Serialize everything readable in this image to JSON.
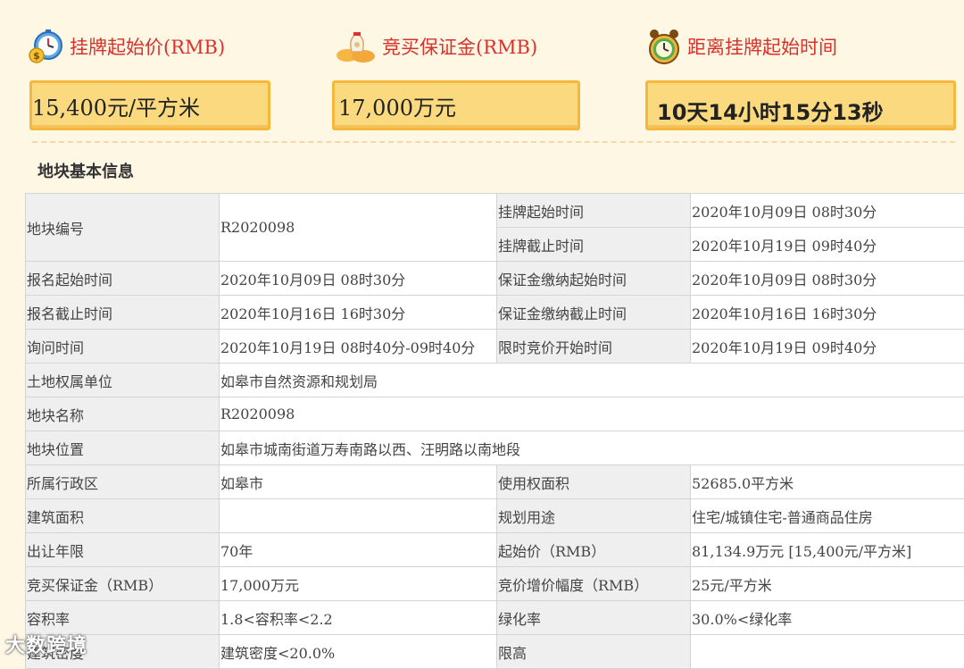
{
  "header": {
    "price_label": "挂牌起始价(RMB)",
    "deposit_label": "竞买保证金(RMB)",
    "countdown_label": "距离挂牌起始时间",
    "price_value": "15,400元/平方米",
    "deposit_value": "17,000万元",
    "countdown_value": "10天14小时15分13秒"
  },
  "section_title": "地块基本信息",
  "table": {
    "r1": {
      "k1": "地块编号",
      "v1": "R2020098",
      "k2": "挂牌起始时间",
      "v2": "2020年10月09日 08时30分"
    },
    "r1b": {
      "k2": "挂牌截止时间",
      "v2": "2020年10月19日 09时40分"
    },
    "r2": {
      "k1": "报名起始时间",
      "v1": "2020年10月09日 08时30分",
      "k2": "保证金缴纳起始时间",
      "v2": "2020年10月09日 08时30分"
    },
    "r3": {
      "k1": "报名截止时间",
      "v1": "2020年10月16日 16时30分",
      "k2": "保证金缴纳截止时间",
      "v2": "2020年10月16日 16时30分"
    },
    "r4": {
      "k1": "询问时间",
      "v1": "2020年10月19日 08时40分-09时40分",
      "k2": "限时竞价开始时间",
      "v2": "2020年10月19日 09时40分"
    },
    "r5": {
      "k1": "土地权属单位",
      "v1": "如皋市自然资源和规划局"
    },
    "r6": {
      "k1": "地块名称",
      "v1": "R2020098"
    },
    "r7": {
      "k1": "地块位置",
      "v1": "如皋市城南街道万寿南路以西、汪明路以南地段"
    },
    "r8": {
      "k1": "所属行政区",
      "v1": "如皋市",
      "k2": "使用权面积",
      "v2": "52685.0平方米"
    },
    "r9": {
      "k1": "建筑面积",
      "v1": "",
      "k2": "规划用途",
      "v2": "住宅/城镇住宅-普通商品住房"
    },
    "r10": {
      "k1": "出让年限",
      "v1": "70年",
      "k2": "起始价（RMB）",
      "v2": "81,134.9万元 [15,400元/平方米]"
    },
    "r11": {
      "k1": "竞买保证金（RMB）",
      "v1": "17,000万元",
      "k2": "竞价增价幅度（RMB）",
      "v2": "25元/平方米"
    },
    "r12": {
      "k1": "容积率",
      "v1": "1.8<容积率<2.2",
      "k2": "绿化率",
      "v2": "30.0%<绿化率"
    },
    "r13": {
      "k1": "建筑密度",
      "v1": "建筑密度<20.0%",
      "k2": "限高",
      "v2": ""
    }
  },
  "watermark": "大数跨境",
  "icons": {
    "price": "stopwatch-dollar-icon",
    "deposit": "money-bag-icon",
    "countdown": "alarm-clock-icon"
  },
  "colors": {
    "label_red": "#d9312b",
    "box_fill": "#fbd97e",
    "box_border": "#f6b83a"
  }
}
